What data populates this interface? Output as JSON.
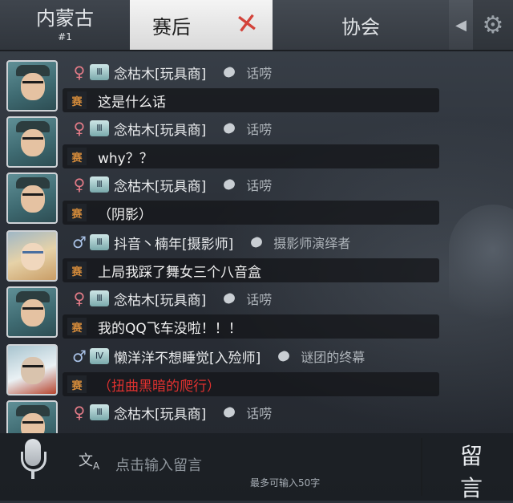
{
  "tabs": {
    "region": {
      "label": "内蒙古",
      "sub": "#1"
    },
    "postgame": {
      "label": "赛后"
    },
    "association": {
      "label": "协会"
    }
  },
  "messages": [
    {
      "gender": "♀",
      "name": "念枯木[玩具商]",
      "title": "话唠",
      "tag": "赛",
      "text": "这是什么话"
    },
    {
      "gender": "♀",
      "name": "念枯木[玩具商]",
      "title": "话唠",
      "tag": "赛",
      "text": "why？？"
    },
    {
      "gender": "♀",
      "name": "念枯木[玩具商]",
      "title": "话唠",
      "tag": "赛",
      "text": "（阴影）"
    },
    {
      "gender": "♂",
      "name": "抖音丶楠年[摄影师]",
      "title": "摄影师演绎者",
      "tag": "赛",
      "text": "上局我踩了舞女三个八音盒"
    },
    {
      "gender": "♀",
      "name": "念枯木[玩具商]",
      "title": "话唠",
      "tag": "赛",
      "text": "我的QQ飞车没啦！！！"
    },
    {
      "gender": "♂",
      "name": "懒洋洋不想睡觉[入殓师]",
      "title": "谜团的终幕",
      "tag": "赛",
      "text": "（扭曲黑暗的爬行）"
    },
    {
      "gender": "♀",
      "name": "念枯木[玩具商]",
      "title": "话唠"
    }
  ],
  "input": {
    "placeholder": "点击输入留言",
    "limit": "最多可输入50字"
  },
  "submit": {
    "label": "留言"
  },
  "colors": {
    "red_text": "#e0312f",
    "tag_color": "#d1893a",
    "female": "#e07a86",
    "male": "#a9c2e6"
  }
}
